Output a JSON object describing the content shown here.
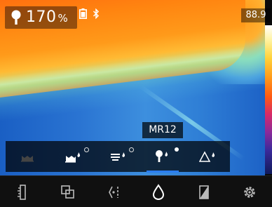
{
  "overlay": {
    "zoom_value": "170",
    "zoom_unit": "%",
    "max_temp": "88.9",
    "mode_label": "MR12"
  },
  "status": {
    "icons": [
      "battery-icon",
      "bluetooth-icon"
    ]
  },
  "submodes": {
    "items": [
      {
        "name": "submode-ambient",
        "icon": "ambient-icon",
        "indicator": "none",
        "active": false
      },
      {
        "name": "submode-surface",
        "icon": "surface-moisture-icon",
        "indicator": "ring",
        "active": false
      },
      {
        "name": "submode-stacked",
        "icon": "stacked-moisture-icon",
        "indicator": "ring",
        "active": false
      },
      {
        "name": "submode-pin",
        "icon": "pin-moisture-icon",
        "indicator": "filled",
        "active": true
      },
      {
        "name": "submode-delta",
        "icon": "delta-moisture-icon",
        "indicator": "none",
        "active": false
      }
    ]
  },
  "toolbar": {
    "items": [
      {
        "name": "tool-ruler",
        "icon": "ruler-icon"
      },
      {
        "name": "tool-overlay",
        "icon": "overlay-icon"
      },
      {
        "name": "tool-crosshair",
        "icon": "crosshair-icon"
      },
      {
        "name": "tool-moisture",
        "icon": "water-drop-icon"
      },
      {
        "name": "tool-palette",
        "icon": "palette-icon"
      },
      {
        "name": "tool-settings",
        "icon": "gear-icon"
      }
    ]
  },
  "colors": {
    "accent": "#2a7df0",
    "scale_top": "#ffffff",
    "scale_bottom": "#101a5a"
  }
}
